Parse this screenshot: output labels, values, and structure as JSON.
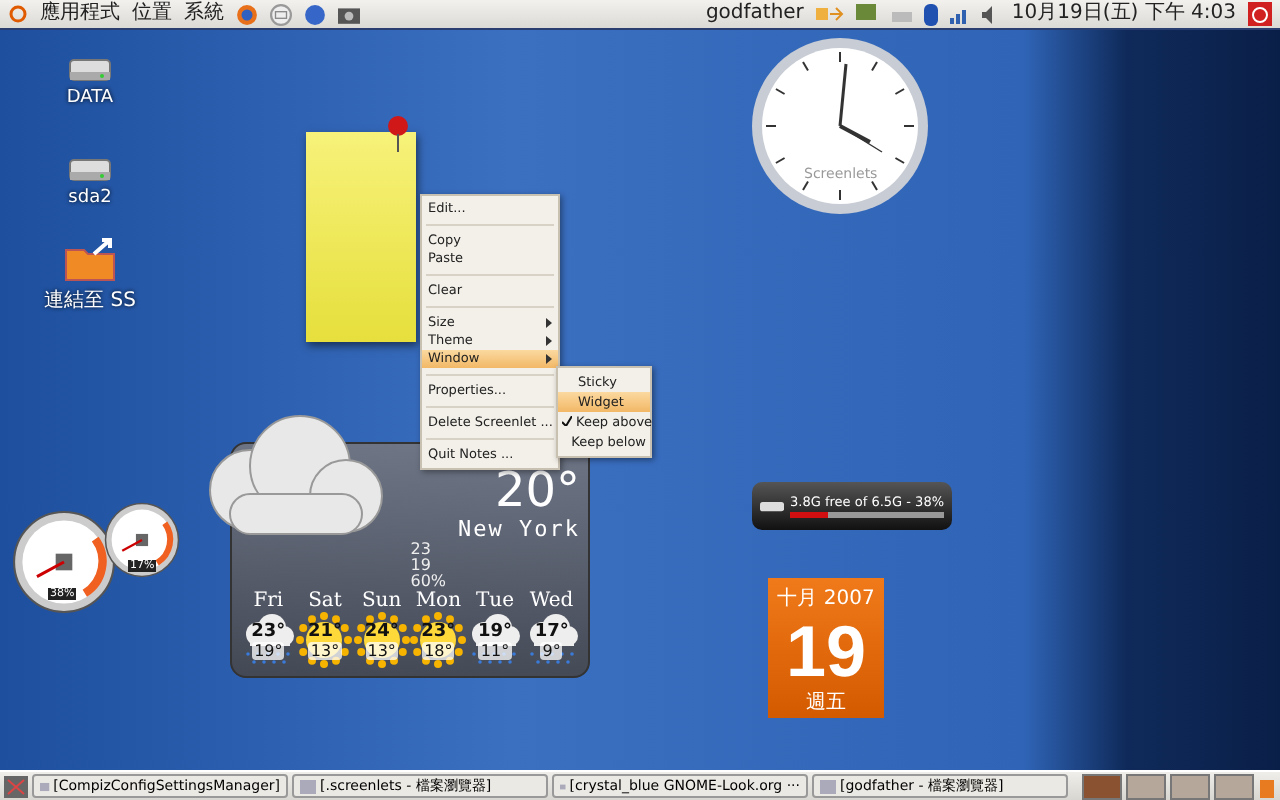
{
  "top_panel": {
    "menus": [
      "應用程式",
      "位置",
      "系統"
    ],
    "user": "godfather",
    "clock": "10月19日(五) 下午 4:03"
  },
  "desktop_icons": [
    {
      "kind": "drive",
      "label": "DATA"
    },
    {
      "kind": "drive",
      "label": "sda2"
    },
    {
      "kind": "folder",
      "label": "連結至 SS"
    }
  ],
  "clock_widget": {
    "label": "Screenlets"
  },
  "context_menu": {
    "items": [
      {
        "kind": "item",
        "label": "Edit...",
        "selected": false
      },
      {
        "kind": "separator"
      },
      {
        "kind": "item",
        "label": "Copy",
        "selected": false
      },
      {
        "kind": "item",
        "label": "Paste",
        "selected": false
      },
      {
        "kind": "separator"
      },
      {
        "kind": "item",
        "label": "Clear",
        "selected": false
      },
      {
        "kind": "separator"
      },
      {
        "kind": "submenu",
        "label": "Size",
        "selected": false
      },
      {
        "kind": "submenu",
        "label": "Theme",
        "selected": false
      },
      {
        "kind": "submenu",
        "label": "Window",
        "selected": true
      },
      {
        "kind": "separator"
      },
      {
        "kind": "item",
        "label": "Properties...",
        "selected": false
      },
      {
        "kind": "separator"
      },
      {
        "kind": "item",
        "label": "Delete Screenlet ...",
        "selected": false
      },
      {
        "kind": "separator"
      },
      {
        "kind": "item",
        "label": "Quit Notes ...",
        "selected": false
      }
    ],
    "submenu": [
      {
        "label": "Sticky",
        "selected": false,
        "checked": false
      },
      {
        "label": "Widget",
        "selected": true,
        "checked": false
      },
      {
        "label": "Keep above",
        "selected": false,
        "checked": true
      },
      {
        "label": "Keep below",
        "selected": false,
        "checked": false
      }
    ]
  },
  "weather": {
    "high": "23",
    "low": "19",
    "humidity": "60%",
    "temperature": "20°",
    "city": "New York",
    "forecast": [
      {
        "day": "Fri",
        "kind": "rain",
        "high": "23°",
        "low": "19°"
      },
      {
        "day": "Sat",
        "kind": "sun",
        "high": "21°",
        "low": "13°"
      },
      {
        "day": "Sun",
        "kind": "sun",
        "high": "24°",
        "low": "13°"
      },
      {
        "day": "Mon",
        "kind": "sun",
        "high": "23°",
        "low": "18°"
      },
      {
        "day": "Tue",
        "kind": "rain",
        "high": "19°",
        "low": "11°"
      },
      {
        "day": "Wed",
        "kind": "rain",
        "high": "17°",
        "low": "9°"
      }
    ]
  },
  "gauges": [
    {
      "reading": "38%"
    },
    {
      "reading": "17%"
    }
  ],
  "disk": {
    "text": "3.8G free of 6.5G - 38%",
    "level": 0.25
  },
  "calendar": {
    "month": "十月 2007",
    "day": "19",
    "weekday": "週五"
  },
  "taskbar": {
    "windows": [
      "[CompizConfigSettingsManager]",
      "[.screenlets - 檔案瀏覽器]",
      "[crystal_blue GNOME-Look.org ···",
      "[godfather - 檔案瀏覽器]"
    ],
    "workspaces": [
      {
        "selected": true
      },
      {
        "selected": false
      },
      {
        "selected": false
      },
      {
        "selected": false
      }
    ]
  }
}
